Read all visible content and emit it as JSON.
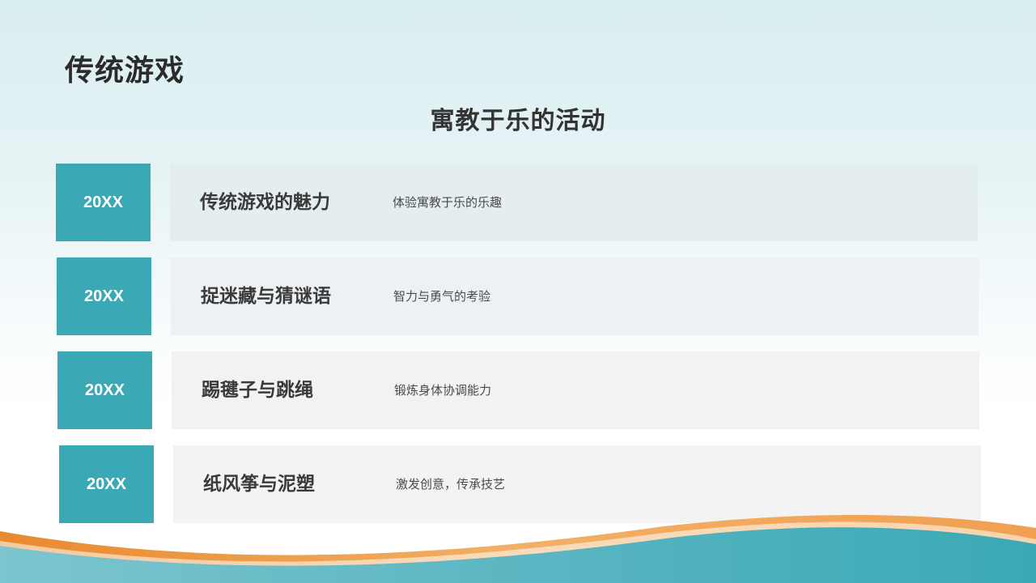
{
  "slide": {
    "title": "传统游戏",
    "subtitle": "寓教于乐的活动"
  },
  "items": [
    {
      "year": "20XX",
      "title": "传统游戏的魅力",
      "desc": "体验寓教于乐的乐趣"
    },
    {
      "year": "20XX",
      "title": "捉迷藏与猜谜语",
      "desc": "智力与勇气的考验"
    },
    {
      "year": "20XX",
      "title": "踢毽子与跳绳",
      "desc": "锻炼身体协调能力"
    },
    {
      "year": "20XX",
      "title": "纸风筝与泥塑",
      "desc": "激发创意，传承技艺"
    }
  ],
  "colors": {
    "accent": "#3aa9b5",
    "wave_orange": "#f0a050",
    "card_bg": "#f2f2f2",
    "title_text": "#2b2b2b"
  }
}
